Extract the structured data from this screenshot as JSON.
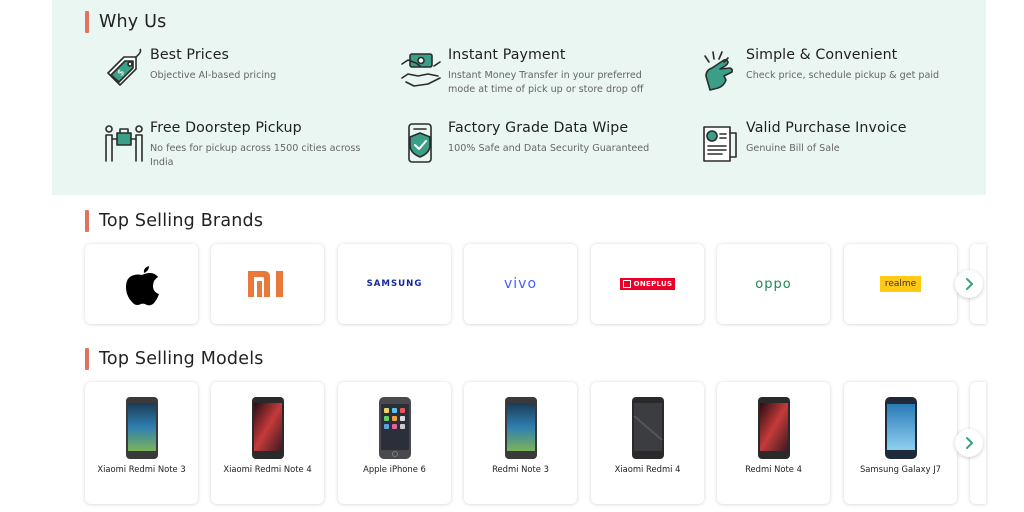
{
  "why_us": {
    "title": "Why Us",
    "features": [
      {
        "icon": "price-tag-icon",
        "title": "Best Prices",
        "desc_lines": [
          "Objective AI-based pricing"
        ]
      },
      {
        "icon": "payment-hand-icon",
        "title": "Instant Payment",
        "desc_lines": [
          "Instant Money Transfer in your preferred",
          "mode at time of pick up or store drop off"
        ]
      },
      {
        "icon": "snap-fingers-icon",
        "title": "Simple & Convenient",
        "desc_lines": [
          "Check price, schedule pickup & get paid"
        ]
      },
      {
        "icon": "doorstep-pickup-icon",
        "title": "Free Doorstep Pickup",
        "desc_lines": [
          "No fees for pickup across 1500 cities across",
          "India"
        ]
      },
      {
        "icon": "phone-shield-icon",
        "title": "Factory Grade Data Wipe",
        "desc_lines": [
          "100% Safe and Data Security Guaranteed"
        ]
      },
      {
        "icon": "invoice-icon",
        "title": "Valid Purchase Invoice",
        "desc_lines": [
          "Genuine Bill of Sale"
        ]
      }
    ]
  },
  "brands": {
    "title": "Top Selling Brands",
    "items": [
      {
        "name": "apple",
        "label": ""
      },
      {
        "name": "mi",
        "label": ""
      },
      {
        "name": "samsung",
        "label": "SAMSUNG"
      },
      {
        "name": "vivo",
        "label": "vivo"
      },
      {
        "name": "oneplus",
        "label": "ONEPLUS"
      },
      {
        "name": "oppo",
        "label": "oppo"
      },
      {
        "name": "realme",
        "label": "realme"
      }
    ]
  },
  "models": {
    "title": "Top Selling Models",
    "items": [
      {
        "label": "Xiaomi Redmi Note 3",
        "screen": "blue"
      },
      {
        "label": "Xiaomi Redmi Note 4",
        "screen": "red"
      },
      {
        "label": "Apple iPhone 6",
        "screen": "ios"
      },
      {
        "label": "Redmi Note 3",
        "screen": "blue"
      },
      {
        "label": "Xiaomi Redmi 4",
        "screen": "dark"
      },
      {
        "label": "Redmi Note 4",
        "screen": "red"
      },
      {
        "label": "Samsung Galaxy J7",
        "screen": "samsung"
      }
    ]
  },
  "colors": {
    "accent": "#e0735e",
    "panel_bg": "#eaf6f1",
    "icon_teal": "#3a9f86",
    "mi_orange": "#e8793a",
    "vivo_blue": "#415fff",
    "oppo_green": "#1d8a4f",
    "oneplus_red": "#eb0028",
    "realme_yellow": "#ffc915"
  }
}
